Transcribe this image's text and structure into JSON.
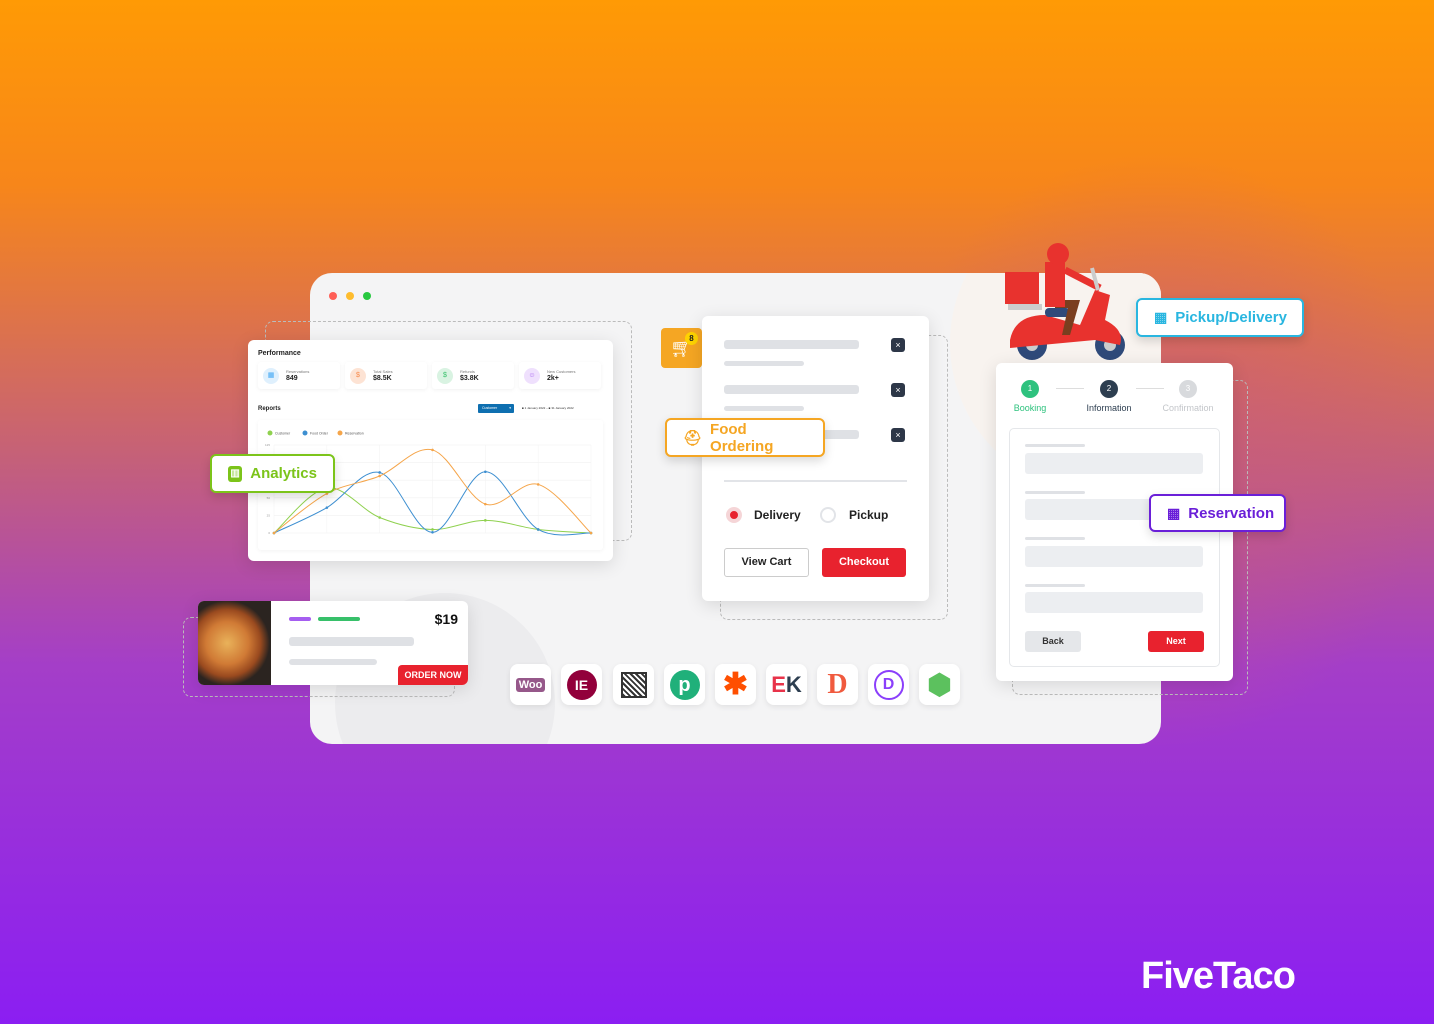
{
  "colors": {
    "accent_red": "#e8222e",
    "analytics_green": "#7cc41a",
    "food_orange": "#f5a623",
    "pickup_cyan": "#29b6e0",
    "reservation_purple": "#6a1fd8"
  },
  "dashboard": {
    "performance_title": "Performance",
    "stats": [
      {
        "label": "Reservations",
        "value": "849",
        "icon": "calendar-icon",
        "color": "#3da5f4"
      },
      {
        "label": "Total Sales",
        "value": "$8.5K",
        "icon": "dollar-icon",
        "color": "#f7894a"
      },
      {
        "label": "Refunds",
        "value": "$3.8K",
        "icon": "refund-icon",
        "color": "#37c06a"
      },
      {
        "label": "New Customers",
        "value": "2k+",
        "icon": "user-icon",
        "color": "#a55ef0"
      }
    ],
    "reports_title": "Reports",
    "filter": "Customer",
    "date_from": "1 January 2022",
    "date_to": "31 January 2022"
  },
  "chart_data": {
    "type": "line",
    "ylim": [
      0,
      125
    ],
    "yticks": [
      "0",
      "25",
      "50",
      "75",
      "100",
      "125"
    ],
    "grid": true,
    "legend": "top-left",
    "x": [
      1,
      2,
      3,
      4,
      5,
      6,
      7
    ],
    "series": [
      {
        "name": "Customer",
        "color": "#8fd14f",
        "values": [
          0,
          64,
          22,
          5,
          18,
          5,
          0
        ]
      },
      {
        "name": "Food Order",
        "color": "#3d8fd1",
        "values": [
          0,
          36,
          86,
          1,
          87,
          5,
          0
        ]
      },
      {
        "name": "Reservation",
        "color": "#f5a54a",
        "values": [
          0,
          56,
          81,
          118,
          41,
          69,
          0
        ]
      }
    ]
  },
  "tags": {
    "analytics": "Analytics",
    "food_ordering": "Food Ordering",
    "pickup_delivery": "Pickup/Delivery",
    "reservation": "Reservation"
  },
  "cart": {
    "badge": "8",
    "delivery": "Delivery",
    "pickup": "Pickup",
    "selected": "Delivery",
    "view_cart": "View Cart",
    "checkout": "Checkout"
  },
  "pizza": {
    "price": "$19",
    "order": "ORDER NOW"
  },
  "booking": {
    "steps": [
      {
        "num": "1",
        "label": "Booking",
        "state": "done"
      },
      {
        "num": "2",
        "label": "Information",
        "state": "active"
      },
      {
        "num": "3",
        "label": "Confirmation",
        "state": "pending"
      }
    ],
    "back": "Back",
    "next": "Next"
  },
  "integrations": [
    "WooCommerce",
    "Elementor",
    "QR Code",
    "Pabbly",
    "Zapier",
    "Elementskit",
    "Dokan",
    "Divi",
    "Gutenberg"
  ],
  "brand": "FiveTaco"
}
